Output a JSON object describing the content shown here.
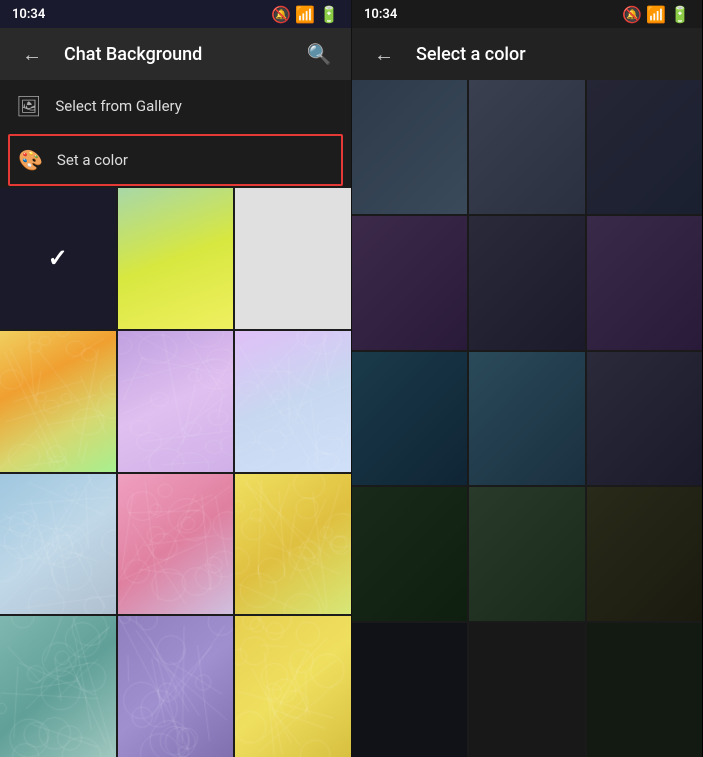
{
  "left_panel": {
    "status_time": "10:34",
    "app_bar_title": "Chat Background",
    "back_icon": "←",
    "search_icon": "🔍",
    "menu_items": [
      {
        "id": "gallery",
        "icon": "🖼",
        "label": "Select from Gallery",
        "highlighted": false
      },
      {
        "id": "color",
        "icon": "🎨",
        "label": "Set a color",
        "highlighted": true
      }
    ],
    "wallpapers": [
      {
        "type": "dark",
        "selected": true
      },
      {
        "type": "gradient-green-yellow"
      },
      {
        "type": "light-gray"
      },
      {
        "type": "doodle-yellow"
      },
      {
        "type": "doodle-purple"
      },
      {
        "type": "doodle-lavender"
      },
      {
        "type": "doodle-blue"
      },
      {
        "type": "doodle-pink"
      },
      {
        "type": "doodle-yellow2"
      },
      {
        "type": "doodle-teal"
      },
      {
        "type": "doodle-purple2"
      },
      {
        "type": "doodle-yellow3"
      }
    ]
  },
  "right_panel": {
    "status_time": "10:34",
    "app_bar_title": "Select a color",
    "back_icon": "←",
    "colors": [
      "#2d3a4a",
      "#3a4a5a",
      "#2a3040",
      "#3d2a4a",
      "#2a2a3a",
      "#3a2a4a",
      "#1a3a4a",
      "#2a4a5a",
      "#3a2a3a",
      "#1a2a1a",
      "#2a3a2a",
      "#3a3a2a",
      "#1a1a2a",
      "#2a2a2a",
      "#1a2a1a"
    ]
  }
}
